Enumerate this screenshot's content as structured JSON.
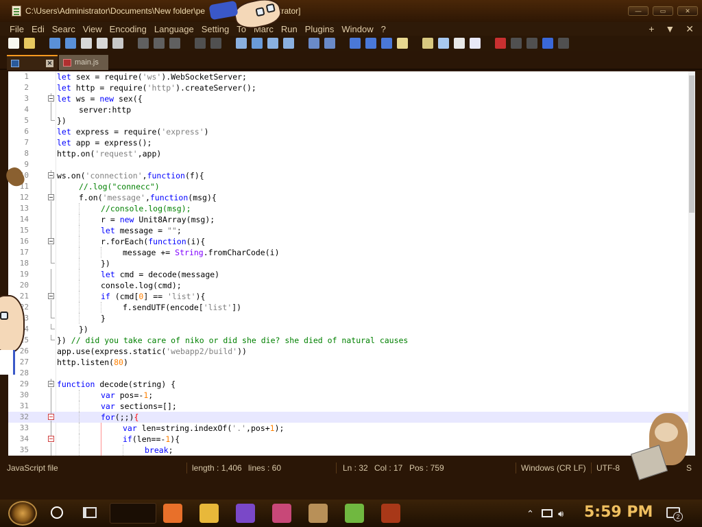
{
  "window": {
    "title": "C:\\Users\\Administrator\\Documents\\New folder\\pe",
    "title_suffix": "dministrator]",
    "controls": [
      "—",
      "▭",
      "✕"
    ]
  },
  "menu": {
    "items": [
      "File",
      "Edi",
      "Searc",
      "View",
      "Encoding",
      "Language",
      "Setting",
      "To",
      "Marc",
      "Run",
      "Plugins",
      "Window",
      "?"
    ],
    "right": [
      "+",
      "▼",
      "✕"
    ]
  },
  "toolbar": {
    "icons": [
      "new-file-icon",
      "open-file-icon",
      "save-icon",
      "save-all-icon",
      "close-icon",
      "close-all-icon",
      "print-icon",
      "cut-icon",
      "copy-icon",
      "paste-icon",
      "undo-icon",
      "redo-icon",
      "find-icon",
      "replace-icon",
      "zoom-in-icon",
      "zoom-out-icon",
      "sync-v-icon",
      "sync-h-icon",
      "wrap-icon",
      "all-chars-icon",
      "indent-guide-icon",
      "udl-icon",
      "doc-map-icon",
      "function-list-icon",
      "folder-workspace-icon",
      "monitor-icon",
      "record-macro-icon",
      "stop-macro-icon",
      "play-macro-icon",
      "run-macro-icon",
      "save-macro-icon"
    ]
  },
  "tabs": [
    {
      "label": "",
      "active": true
    },
    {
      "label": "main.js",
      "active": false
    }
  ],
  "editor": {
    "current_line": 32,
    "lines": [
      {
        "n": "1",
        "fold": "",
        "indent": 0,
        "html": "<span class='kw'>let</span> sex = require(<span class='str'>'ws'</span>).WebSocketServer;"
      },
      {
        "n": "2",
        "fold": "",
        "indent": 0,
        "html": "<span class='kw'>let</span> http = require(<span class='str'>'http'</span>).createServer();"
      },
      {
        "n": "3",
        "fold": "box",
        "indent": 0,
        "html": "<span class='kw'>let</span> ws = <span class='kw'>new</span> sex({"
      },
      {
        "n": "4",
        "fold": "line",
        "indent": 1,
        "html": "server:http"
      },
      {
        "n": "5",
        "fold": "end",
        "indent": 0,
        "html": "})"
      },
      {
        "n": "6",
        "fold": "",
        "indent": 0,
        "html": "<span class='kw'>let</span> express = require(<span class='str'>'express'</span>)"
      },
      {
        "n": "7",
        "fold": "",
        "indent": 0,
        "html": "<span class='kw'>let</span> app = express();"
      },
      {
        "n": "8",
        "fold": "",
        "indent": 0,
        "html": "http.on(<span class='str'>'request'</span>,app)"
      },
      {
        "n": "9",
        "fold": "",
        "indent": 0,
        "html": ""
      },
      {
        "n": "10",
        "fold": "box",
        "indent": 0,
        "html": "ws.on(<span class='str'>'connection'</span>,<span class='kw'>function</span>(f){"
      },
      {
        "n": "11",
        "fold": "line",
        "indent": 1,
        "html": "<span class='cmt'>//.log(\"connecc\")</span>"
      },
      {
        "n": "12",
        "fold": "box",
        "indent": 1,
        "html": "f.on(<span class='str'>'message'</span>,<span class='kw'>function</span>(msg){"
      },
      {
        "n": "13",
        "fold": "line",
        "indent": 2,
        "html": "<span class='cmt'>//console.log(msg);</span>"
      },
      {
        "n": "14",
        "fold": "line",
        "indent": 2,
        "html": "r = <span class='kw'>new</span> Unit8Array(msg);"
      },
      {
        "n": "15",
        "fold": "line",
        "indent": 2,
        "html": "<span class='kw'>let</span> message = <span class='str'>\"\"</span>;"
      },
      {
        "n": "16",
        "fold": "box",
        "indent": 2,
        "html": "r.forEach(<span class='kw'>function</span>(i){"
      },
      {
        "n": "17",
        "fold": "line",
        "indent": 3,
        "html": "message += <span class='obj'>String</span>.fromCharCode(i)"
      },
      {
        "n": "18",
        "fold": "end",
        "indent": 2,
        "html": "})"
      },
      {
        "n": "19",
        "fold": "line",
        "indent": 2,
        "html": "<span class='kw'>let</span> cmd = decode(message)"
      },
      {
        "n": "20",
        "fold": "line",
        "indent": 2,
        "html": "console.log(cmd);"
      },
      {
        "n": "21",
        "fold": "box",
        "indent": 2,
        "html": "<span class='kw'>if</span> (cmd[<span class='num'>0</span>] == <span class='str'>'list'</span>){"
      },
      {
        "n": "22",
        "fold": "line",
        "indent": 3,
        "html": "f.sendUTF(encode[<span class='str'>'list'</span>])"
      },
      {
        "n": "23",
        "fold": "end",
        "indent": 2,
        "html": "}"
      },
      {
        "n": "24",
        "fold": "end",
        "indent": 1,
        "html": "})"
      },
      {
        "n": "25",
        "fold": "end",
        "indent": 0,
        "html": "}) <span class='cmt'>// did you take care of niko or did she die? she died of natural causes</span>"
      },
      {
        "n": "26",
        "fold": "",
        "indent": 0,
        "html": "app.use(express.static(<span class='str'>'webapp2/build'</span>))"
      },
      {
        "n": "27",
        "fold": "",
        "indent": 0,
        "html": "http.listen(<span class='num'>80</span>)"
      },
      {
        "n": "28",
        "fold": "",
        "indent": 0,
        "html": ""
      },
      {
        "n": "29",
        "fold": "box",
        "indent": 0,
        "html": "<span class='kw'>function</span> decode(string) {"
      },
      {
        "n": "30",
        "fold": "line",
        "indent": 2,
        "html": "<span class='kw'>var</span> pos=-<span class='num'>1</span>;"
      },
      {
        "n": "31",
        "fold": "line",
        "indent": 2,
        "html": "<span class='kw'>var</span> sections=[];"
      },
      {
        "n": "32",
        "fold": "redbox",
        "indent": 2,
        "html": "<span class='kw'>for</span>(;;)<span class='brc'>{</span>"
      },
      {
        "n": "33",
        "fold": "line",
        "indent": 3,
        "html": "<span class='kw'>var</span> len=string.indexOf(<span class='str'>'.'</span>,pos+<span class='num'>1</span>);"
      },
      {
        "n": "34",
        "fold": "redbox",
        "indent": 3,
        "html": "<span class='kw'>if</span>(len==-<span class='num'>1</span>){"
      },
      {
        "n": "35",
        "fold": "line",
        "indent": 4,
        "html": "<span class='kw'>break</span>;"
      }
    ]
  },
  "status": {
    "file_type": "JavaScript file",
    "length": "length : 1,406",
    "lines": "lines : 60",
    "ln": "Ln : 32",
    "col": "Col : 17",
    "pos": "Pos : 759",
    "eol": "Windows (CR LF)",
    "encoding": "UTF-8",
    "mode": "S"
  },
  "taskbar": {
    "apps": [
      {
        "name": "firefox",
        "color": "#e8702a"
      },
      {
        "name": "file-explorer",
        "color": "#e8b83a"
      },
      {
        "name": "visual-studio",
        "color": "#7a48c8"
      },
      {
        "name": "game-app",
        "color": "#c84878"
      },
      {
        "name": "image-app",
        "color": "#b89058"
      },
      {
        "name": "notepad-plus",
        "color": "#70b840"
      },
      {
        "name": "media-app",
        "color": "#a83818"
      }
    ],
    "clock": "5:59 PM",
    "notifications": "2"
  }
}
